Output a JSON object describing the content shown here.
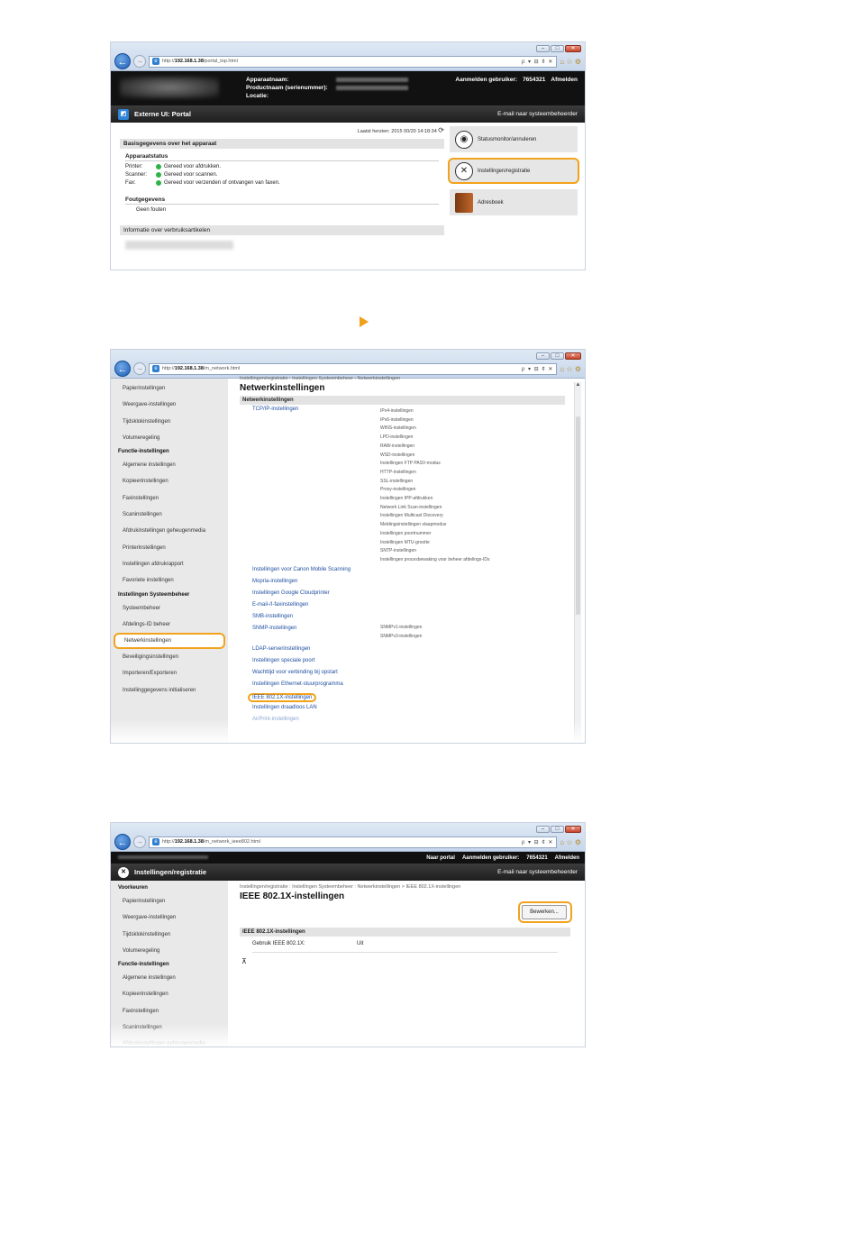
{
  "browser": {
    "url1": "http://192.168.1.38/portal_top.html",
    "url2": "http://192.168.1.38/m_network.html",
    "url3": "http://192.168.1.38/m_network_ieee802.html",
    "url_host": "192.168.1.38",
    "tools": "ρ ▾ ⊟ ¢ ✕",
    "favs": "⌂ ☆ ⚙"
  },
  "portal": {
    "device_name_label": "Apparaatnaam:",
    "product_name_label": "Productnaam (serienummer):",
    "location_label": "Locatie:",
    "login_user_label": "Aanmelden gebruiker:",
    "login_user_value": "7654321",
    "logout": "Afmelden",
    "bar_title": "Externe UI: Portal",
    "mail_admin": "E-mail naar systeembeheerder",
    "last_updated": "Laatst herzien: 2015 00/20 14:18:34",
    "basic_info_header": "Basisgegevens over het apparaat",
    "device_status_header": "Apparaatstatus",
    "status_rows": [
      {
        "key": "Printer:",
        "value": "Gereed voor afdrukken."
      },
      {
        "key": "Scanner:",
        "value": "Gereed voor scannen."
      },
      {
        "key": "Fax:",
        "value": "Gereed voor verzenden of ontvangen van faxen."
      }
    ],
    "error_header": "Foutgegevens",
    "error_value": "Geen fouten",
    "consumables_header": "Informatie over verbruiksartikelen",
    "tiles": [
      {
        "label": "Statusmonitor/annuleren"
      },
      {
        "label": "Instellingen/registratie"
      },
      {
        "label": "Adresboek"
      }
    ]
  },
  "network": {
    "sidebar": [
      {
        "type": "item",
        "label": "Papierinstellingen"
      },
      {
        "type": "item",
        "label": "Weergave-instellingen"
      },
      {
        "type": "item",
        "label": "Tijdsklokinstellingen"
      },
      {
        "type": "item",
        "label": "Volumeregeling"
      },
      {
        "type": "cat",
        "label": "Functie-instellingen"
      },
      {
        "type": "item",
        "label": "Algemene instellingen"
      },
      {
        "type": "item",
        "label": "Kopieerinstellingen"
      },
      {
        "type": "item",
        "label": "Faxinstellingen"
      },
      {
        "type": "item",
        "label": "Scaninstellingen"
      },
      {
        "type": "item",
        "label": "Afdrukinstellingen geheugenmedia"
      },
      {
        "type": "item",
        "label": "Printerinstellingen"
      },
      {
        "type": "item",
        "label": "Instellingen afdrukrapport"
      },
      {
        "type": "item",
        "label": "Favoriete instellingen"
      },
      {
        "type": "cat",
        "label": "Instellingen Systeembeheer"
      },
      {
        "type": "item",
        "label": "Systeembeheer"
      },
      {
        "type": "item",
        "label": "Afdelings-ID beheer"
      },
      {
        "type": "item",
        "label": "Netwerkinstellingen",
        "highlight": true
      },
      {
        "type": "item",
        "label": "Beveiligingsinstellingen"
      },
      {
        "type": "item",
        "label": "Importeren/Exporteren"
      },
      {
        "type": "item",
        "label": "Instellinggegevens initialiseren"
      }
    ],
    "crumb": "Instellingen/registratie : Instellingen Systeembeheer : Netwerkinstellingen",
    "title": "Netwerkinstellingen",
    "section": "Netwerkinstellingen",
    "links": [
      "TCP/IP-instellingen",
      "Instellingen voor Canon Mobile Scanning",
      "Mopria-instellingen",
      "Instellingen Google Cloudprinter",
      "E-mail-/I-faxinstellingen",
      "SMB-instellingen",
      "SNMP-instellingen",
      "LDAP-serverinstellingen",
      "Instellingen speciale poort",
      "Wachttijd voor verbinding bij opstart",
      "Instellingen Ethernet-stuurprogramma",
      "IEEE 802.1X-instellingen",
      "Instellingen draadloos LAN",
      "AirPrint-instellingen"
    ],
    "tcpip_sub": [
      "IPv4-instellingen",
      "IPv6-instellingen",
      "WINS-instellingen",
      "LPD-instellingen",
      "RAW-instellingen",
      "WSD-instellingen",
      "Instellingen FTP PASV-modus",
      "HTTP-instellingen",
      "SSL-instellingen",
      "Proxy-instellingen",
      "Instellingen IPP-afdrukken",
      "Network Link Scan-instellingen",
      "Instellingen Multicast Discovery",
      "Meldingsinstellingen slaapmodus",
      "Instellingen poortnummer",
      "Instellingen MTU-grootte",
      "SNTP-instellingen",
      "Instellingen procesbewaking voor beheer afdelings-IDs"
    ],
    "snmp_sub": [
      "SNMPv1-instellingen",
      "SNMPv3-instellingen"
    ]
  },
  "ieee": {
    "goto_portal": "Naar portal",
    "login_user_label": "Aanmelden gebruiker:",
    "login_user_value": "7654321",
    "logout": "Afmelden",
    "bar_title": "Instellingen/registratie",
    "mail_admin": "E-mail naar systeembeheerder",
    "sidebar": [
      {
        "type": "cat",
        "label": "Voorkeuren"
      },
      {
        "type": "item",
        "label": "Papierinstellingen"
      },
      {
        "type": "item",
        "label": "Weergave-instellingen"
      },
      {
        "type": "item",
        "label": "Tijdsklokinstellingen"
      },
      {
        "type": "item",
        "label": "Volumeregeling"
      },
      {
        "type": "cat",
        "label": "Functie-instellingen"
      },
      {
        "type": "item",
        "label": "Algemene instellingen"
      },
      {
        "type": "item",
        "label": "Kopieerinstellingen"
      },
      {
        "type": "item",
        "label": "Faxinstellingen"
      },
      {
        "type": "item",
        "label": "Scaninstellingen"
      },
      {
        "type": "item",
        "label": "Afdrukinstellingen geheugenmedia"
      }
    ],
    "crumb": "Instellingen/registratie : Instellingen Systeembeheer : Netwerkinstellingen > IEEE 802.1X-instellingen",
    "title": "IEEE 802.1X-instellingen",
    "edit_button": "Bewerken...",
    "section": "IEEE 802.1X-instellingen",
    "use_label": "Gebruik IEEE 802.1X:",
    "use_value": "Uit",
    "top_glyph": "⊼"
  }
}
